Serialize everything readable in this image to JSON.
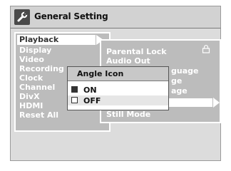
{
  "header": {
    "title": "General Setting",
    "icon": "wrench-icon"
  },
  "menu": {
    "items": [
      {
        "label": "Playback",
        "selected": true
      },
      {
        "label": "Display"
      },
      {
        "label": "Video"
      },
      {
        "label": "Recording"
      },
      {
        "label": "Clock"
      },
      {
        "label": "Channel"
      },
      {
        "label": "DivX"
      },
      {
        "label": "HDMI"
      },
      {
        "label": "Reset All"
      }
    ]
  },
  "submenu": {
    "items": [
      {
        "label": "Parental Lock",
        "icon": "lock-icon"
      },
      {
        "label": "Audio Out"
      },
      {
        "label": "guage"
      },
      {
        "label": "ge"
      },
      {
        "label": "age"
      },
      {
        "label": ""
      },
      {
        "label": "Still Mode"
      }
    ]
  },
  "popup": {
    "title": "Angle Icon",
    "options": [
      {
        "label": "ON",
        "checked": true,
        "selected": true
      },
      {
        "label": "OFF",
        "checked": false,
        "selected": false
      }
    ]
  }
}
